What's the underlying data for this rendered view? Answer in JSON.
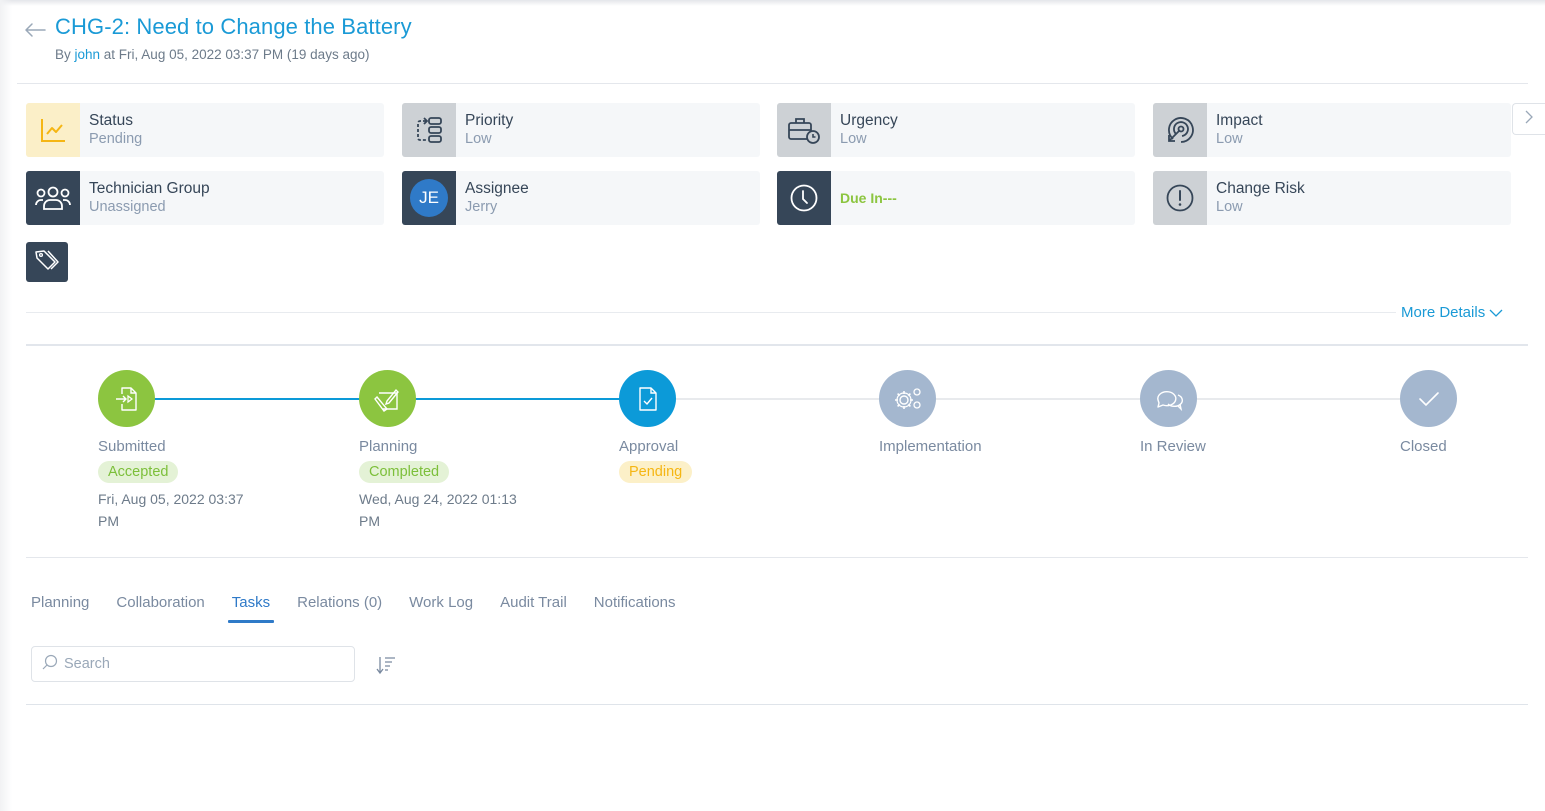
{
  "header": {
    "title": "CHG-2: Need to Change the Battery",
    "by_prefix": "By ",
    "author": "john",
    "created_text": " at Fri, Aug 05, 2022 03:37 PM (19 days ago)"
  },
  "cards": [
    {
      "label": "Status",
      "value": "Pending",
      "icon": "status-chart-icon"
    },
    {
      "label": "Priority",
      "value": "Low",
      "icon": "priority-flow-icon"
    },
    {
      "label": "Urgency",
      "value": "Low",
      "icon": "briefcase-clock-icon"
    },
    {
      "label": "Impact",
      "value": "Low",
      "icon": "target-cursor-icon"
    },
    {
      "label": "Technician Group",
      "value": "Unassigned",
      "icon": "users-icon"
    },
    {
      "label": "Assignee",
      "value": "Jerry",
      "initials": "JE"
    },
    {
      "label": "",
      "value": "Due In---",
      "icon": "clock-icon"
    },
    {
      "label": "Change Risk",
      "value": "Low",
      "icon": "alert-circle-icon"
    }
  ],
  "more_details_label": "More Details",
  "colors": {
    "accent": "#1a9ad6",
    "done": "#8cc540",
    "current": "#0c9ad8",
    "future": "#a4b7cf",
    "pending": "#f5b614"
  },
  "stages": [
    {
      "name": "Submitted",
      "status": "Accepted",
      "date": "Fri, Aug 05, 2022 03:37 PM",
      "state": "done"
    },
    {
      "name": "Planning",
      "status": "Completed",
      "date": "Wed, Aug 24, 2022 01:13 PM",
      "state": "done"
    },
    {
      "name": "Approval",
      "status": "Pending",
      "date": "",
      "state": "current"
    },
    {
      "name": "Implementation",
      "status": "",
      "date": "",
      "state": "future"
    },
    {
      "name": "In Review",
      "status": "",
      "date": "",
      "state": "future"
    },
    {
      "name": "Closed",
      "status": "",
      "date": "",
      "state": "future"
    }
  ],
  "tabs": [
    {
      "label": "Planning",
      "active": false
    },
    {
      "label": "Collaboration",
      "active": false
    },
    {
      "label": "Tasks",
      "active": true
    },
    {
      "label": "Relations (0)",
      "active": false
    },
    {
      "label": "Work Log",
      "active": false
    },
    {
      "label": "Audit Trail",
      "active": false
    },
    {
      "label": "Notifications",
      "active": false
    }
  ],
  "search": {
    "placeholder": "Search",
    "value": ""
  }
}
